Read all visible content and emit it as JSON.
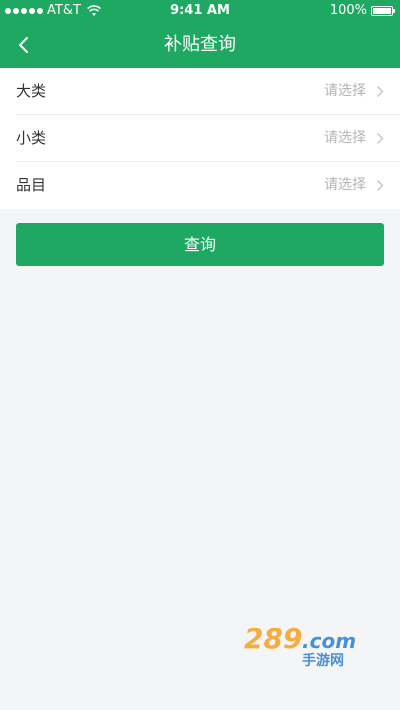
{
  "status_bar": {
    "carrier": "AT&T",
    "time": "9:41 AM",
    "battery": "100%"
  },
  "nav": {
    "title": "补贴查询"
  },
  "form": {
    "rows": [
      {
        "label": "大类",
        "value": "请选择"
      },
      {
        "label": "小类",
        "value": "请选择"
      },
      {
        "label": "品目",
        "value": "请选择"
      }
    ]
  },
  "query_button": {
    "label": "查询"
  },
  "watermark": {
    "text": "289.com 手游网"
  },
  "colors": {
    "primary": "#1fa862",
    "background": "#f4f5f7",
    "placeholder": "#b5b5b5"
  }
}
